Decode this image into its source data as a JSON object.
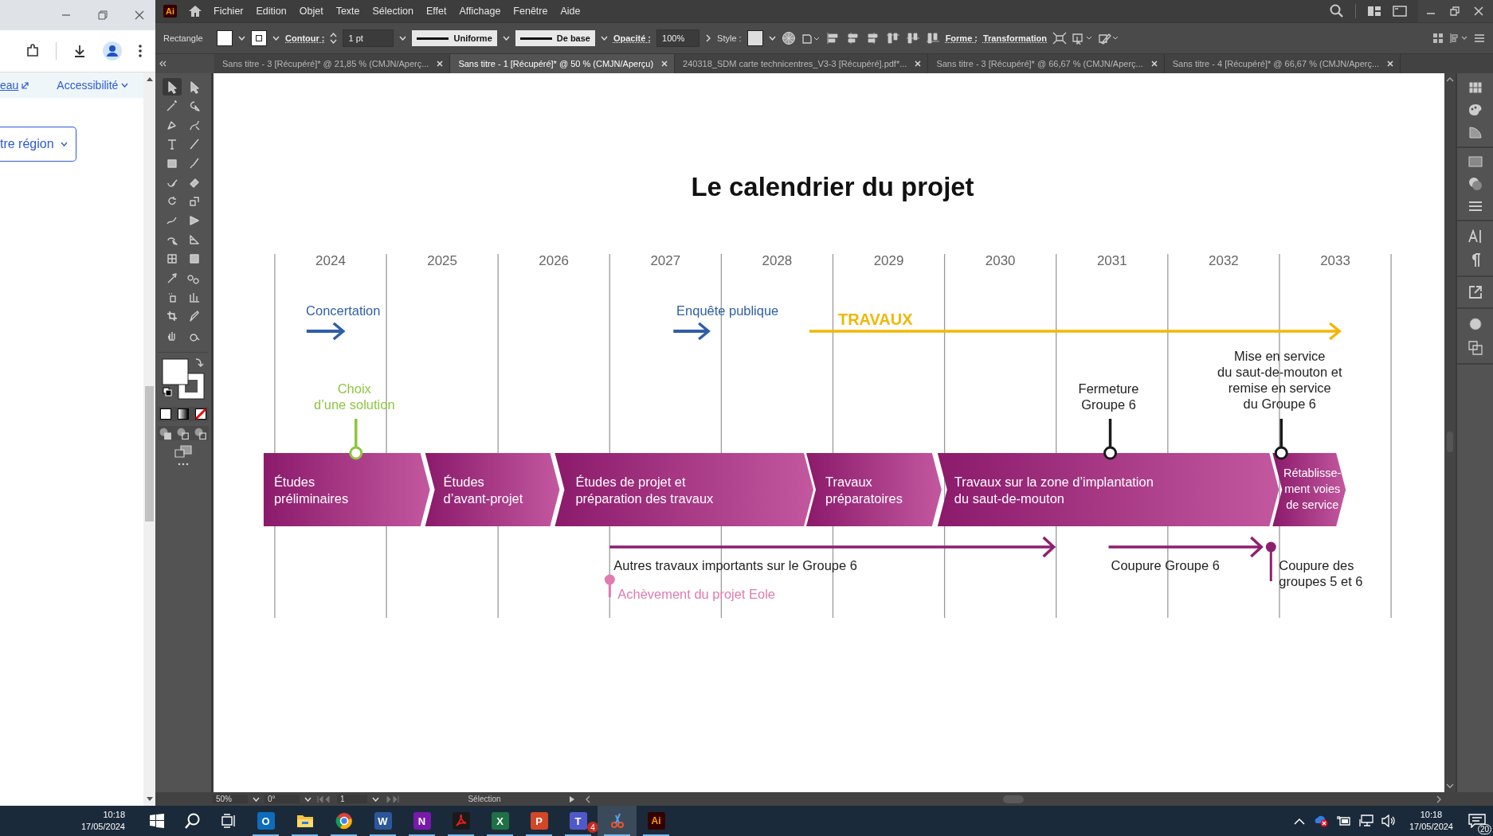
{
  "browser": {
    "link": "eau",
    "menu": "Accessibilité",
    "region_button": "tre région"
  },
  "app": {
    "logo": "Ai",
    "menu": [
      "Fichier",
      "Edition",
      "Objet",
      "Texte",
      "Sélection",
      "Effet",
      "Affichage",
      "Fenêtre",
      "Aide"
    ],
    "control_bar": {
      "tool": "Rectangle",
      "stroke_label": "Contour :",
      "stroke_weight": "1 pt",
      "profile": "Uniforme",
      "brush": "De base",
      "opacity_label": "Opacité :",
      "opacity": "100%",
      "style_label": "Style :",
      "shape_label": "Forme :",
      "transform": "Transformation"
    },
    "tabs": [
      {
        "label": "Sans titre - 3 [Récupéré]* @ 21,85 % (CMJN/Aperç...",
        "selected": false
      },
      {
        "label": "Sans titre - 1 [Récupéré]* @ 50 % (CMJN/Aperçu)",
        "selected": true
      },
      {
        "label": "240318_SDM carte technicentres_V3-3 [Récupéré].pdf*...",
        "selected": false
      },
      {
        "label": "Sans titre - 3 [Récupéré]* @ 66,67 % (CMJN/Aperç...",
        "selected": false
      },
      {
        "label": "Sans titre - 4 [Récupéré]* @ 66,67 % (CMJN/Aperç...",
        "selected": false
      }
    ],
    "status_bar": {
      "zoom": "50%",
      "rotation": "0°",
      "artboard": "1",
      "tool": "Sélection"
    }
  },
  "document": {
    "title": "Le calendrier du projet",
    "years": [
      "2024",
      "2025",
      "2026",
      "2027",
      "2028",
      "2029",
      "2030",
      "2031",
      "2032",
      "2033"
    ],
    "phases": [
      {
        "lines": [
          "Études",
          "préliminaires"
        ]
      },
      {
        "lines": [
          "Études",
          "d’avant-projet"
        ]
      },
      {
        "lines": [
          "Études de projet et",
          "préparation des travaux"
        ]
      },
      {
        "lines": [
          "Travaux",
          "préparatoires"
        ]
      },
      {
        "lines": [
          "Travaux sur la zone d’implantation",
          "du saut-de-mouton"
        ]
      },
      {
        "lines": [
          "Rétablisse-",
          "ment voies",
          "de service"
        ]
      }
    ],
    "above": [
      {
        "kind": "arrow",
        "lines": [
          "Concertation"
        ],
        "color": "#2e5ea8"
      },
      {
        "kind": "arrow",
        "lines": [
          "Enquête publique"
        ],
        "color": "#2e5ea8"
      },
      {
        "kind": "long_arrow",
        "lines": [
          "TRAVAUX"
        ],
        "color": "#f2b705"
      },
      {
        "kind": "pin",
        "lines": [
          "Choix",
          "d’une solution"
        ],
        "color": "#8dc63f"
      },
      {
        "kind": "pin",
        "lines": [
          "Fermeture",
          "Groupe 6"
        ],
        "color": "#1a1a1a"
      },
      {
        "kind": "pin",
        "lines": [
          "Mise en service",
          "du saut-de-mouton et",
          "remise en service",
          "du Groupe 6"
        ],
        "color": "#1a1a1a"
      }
    ],
    "below": [
      {
        "kind": "arrow",
        "lines": [
          "Autres travaux importants sur le Groupe 6"
        ],
        "color": "#8e1f6f"
      },
      {
        "kind": "arrow",
        "lines": [
          "Coupure Groupe 6"
        ],
        "color": "#8e1f6f"
      },
      {
        "kind": "drop",
        "lines": [
          "Coupure des",
          "groupes 5 et 6"
        ],
        "color": "#8e1f6f"
      },
      {
        "kind": "drop",
        "lines": [
          "Achèvement du projet Eole"
        ],
        "color": "#e07ab0"
      }
    ]
  },
  "taskbar": {
    "left_clock": {
      "time": "10:18",
      "date": "17/05/2024"
    },
    "apps": [
      {
        "kind": "outlook",
        "letter": "O"
      },
      {
        "kind": "folder"
      },
      {
        "kind": "chrome"
      },
      {
        "kind": "word",
        "letter": "W"
      },
      {
        "kind": "onenote",
        "letter": "N"
      },
      {
        "kind": "acrobat"
      },
      {
        "kind": "excel",
        "letter": "X"
      },
      {
        "kind": "powerpoint",
        "letter": "P"
      },
      {
        "kind": "teams",
        "letter": "T",
        "badge": "4"
      },
      {
        "kind": "snip"
      },
      {
        "kind": "illustrator",
        "letter": "Ai"
      }
    ],
    "clock": {
      "time": "10:18",
      "date": "17/05/2024"
    },
    "notifications": "20"
  }
}
